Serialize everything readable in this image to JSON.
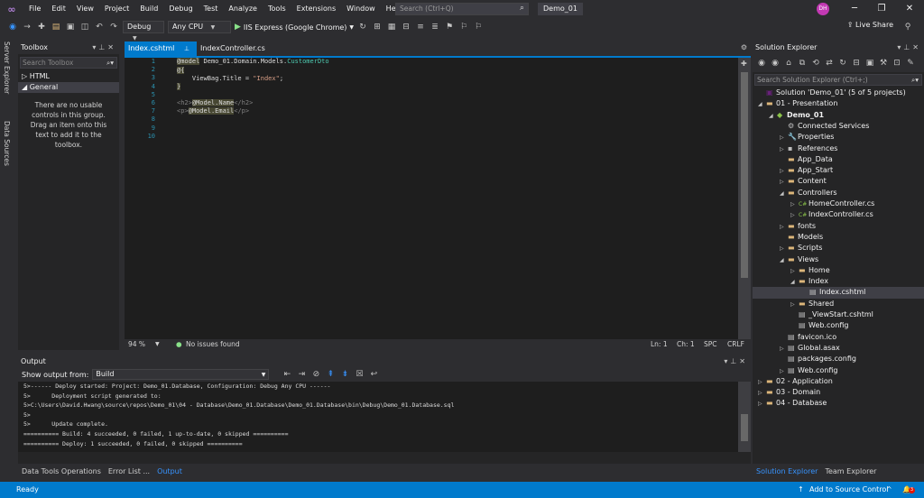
{
  "menu": {
    "items": [
      "File",
      "Edit",
      "View",
      "Project",
      "Build",
      "Debug",
      "Test",
      "Analyze",
      "Tools",
      "Extensions",
      "Window",
      "Help"
    ],
    "search_placeholder": "Search (Ctrl+Q)",
    "solution_name": "Demo_01",
    "avatar_initials": "DH"
  },
  "toolbar": {
    "configuration": "Debug",
    "platform": "Any CPU",
    "run_target": "IIS Express (Google Chrome)",
    "live_share": "Live Share"
  },
  "left_strip": {
    "tab1": "Server Explorer",
    "tab2": "Data Sources"
  },
  "toolbox": {
    "title": "Toolbox",
    "search_placeholder": "Search Toolbox",
    "groups": [
      {
        "label": "HTML",
        "expanded": false
      },
      {
        "label": "General",
        "expanded": true
      }
    ],
    "empty_message": "There are no usable controls in this group. Drag an item onto this text to add it to the toolbox."
  },
  "editor": {
    "tabs": [
      "Index.cshtml",
      "IndexController.cs"
    ],
    "line_numbers": [
      "1",
      "2",
      "3",
      "4",
      "5",
      "6",
      "7",
      "8",
      "9",
      "10"
    ],
    "lines": {
      "l1_directive": "@model",
      "l1_ns": " Demo_01.Domain.Models.",
      "l1_type": "CustomerDto",
      "l2": "@{",
      "l3_prop": "ViewBag.Title = ",
      "l3_str": "\"Index\"",
      "l3_end": ";",
      "l4": "}",
      "l6_open": "<h2>",
      "l6_expr": "@Model.Name",
      "l6_close": "</h2>",
      "l7_open": "<p>",
      "l7_expr": "@Model.Email",
      "l7_close": "</p>"
    },
    "status": {
      "zoom": "94 %",
      "issues": "No issues found",
      "line": "Ln: 1",
      "char": "Ch: 1",
      "spc": "SPC",
      "eol": "CRLF"
    }
  },
  "output": {
    "title": "Output",
    "show_from_label": "Show output from:",
    "source": "Build",
    "lines": [
      "5>------ Deploy started: Project: Demo_01.Database, Configuration: Debug Any CPU ------",
      "5>      Deployment script generated to:",
      "5>C:\\Users\\David.Hwang\\source\\repos\\Demo_01\\04 - Database\\Demo_01.Database\\Demo_01.Database\\bin\\Debug\\Demo_01.Database.sql",
      "5>",
      "5>      Update complete.",
      "========== Build: 4 succeeded, 0 failed, 1 up-to-date, 0 skipped ==========",
      "========== Deploy: 1 succeeded, 0 failed, 0 skipped =========="
    ]
  },
  "bottom_tabs": [
    "Data Tools Operations",
    "Error List ...",
    "Output"
  ],
  "solution_explorer": {
    "title": "Solution Explorer",
    "search_placeholder": "Search Solution Explorer (Ctrl+;)",
    "tree": [
      {
        "label": "Solution 'Demo_01' (5 of 5 projects)",
        "depth": 0,
        "exp": "",
        "icon": "solution"
      },
      {
        "label": "01 - Presentation",
        "depth": 0,
        "exp": "open",
        "icon": "folder"
      },
      {
        "label": "Demo_01",
        "depth": 1,
        "exp": "open",
        "icon": "project",
        "bold": true
      },
      {
        "label": "Connected Services",
        "depth": 2,
        "exp": "",
        "icon": "services"
      },
      {
        "label": "Properties",
        "depth": 2,
        "exp": "closed",
        "icon": "wrench"
      },
      {
        "label": "References",
        "depth": 2,
        "exp": "closed",
        "icon": "refs"
      },
      {
        "label": "App_Data",
        "depth": 2,
        "exp": "",
        "icon": "folder"
      },
      {
        "label": "App_Start",
        "depth": 2,
        "exp": "closed",
        "icon": "folder"
      },
      {
        "label": "Content",
        "depth": 2,
        "exp": "closed",
        "icon": "folder"
      },
      {
        "label": "Controllers",
        "depth": 2,
        "exp": "open",
        "icon": "folder"
      },
      {
        "label": "HomeController.cs",
        "depth": 3,
        "exp": "closed",
        "icon": "cs"
      },
      {
        "label": "IndexController.cs",
        "depth": 3,
        "exp": "closed",
        "icon": "cs"
      },
      {
        "label": "fonts",
        "depth": 2,
        "exp": "closed",
        "icon": "folder"
      },
      {
        "label": "Models",
        "depth": 2,
        "exp": "",
        "icon": "folder"
      },
      {
        "label": "Scripts",
        "depth": 2,
        "exp": "closed",
        "icon": "folder"
      },
      {
        "label": "Views",
        "depth": 2,
        "exp": "open",
        "icon": "folder"
      },
      {
        "label": "Home",
        "depth": 3,
        "exp": "closed",
        "icon": "folder"
      },
      {
        "label": "Index",
        "depth": 3,
        "exp": "open",
        "icon": "folder"
      },
      {
        "label": "Index.cshtml",
        "depth": 4,
        "exp": "",
        "icon": "cshtml",
        "selected": true
      },
      {
        "label": "Shared",
        "depth": 3,
        "exp": "closed",
        "icon": "folder"
      },
      {
        "label": "_ViewStart.cshtml",
        "depth": 3,
        "exp": "",
        "icon": "cshtml"
      },
      {
        "label": "Web.config",
        "depth": 3,
        "exp": "",
        "icon": "config"
      },
      {
        "label": "favicon.ico",
        "depth": 2,
        "exp": "",
        "icon": "file"
      },
      {
        "label": "Global.asax",
        "depth": 2,
        "exp": "closed",
        "icon": "file"
      },
      {
        "label": "packages.config",
        "depth": 2,
        "exp": "",
        "icon": "config"
      },
      {
        "label": "Web.config",
        "depth": 2,
        "exp": "closed",
        "icon": "config"
      },
      {
        "label": "02 - Application",
        "depth": 0,
        "exp": "closed",
        "icon": "folder"
      },
      {
        "label": "03 - Domain",
        "depth": 0,
        "exp": "closed",
        "icon": "folder"
      },
      {
        "label": "04 - Database",
        "depth": 0,
        "exp": "closed",
        "icon": "folder"
      }
    ],
    "tabs": [
      "Solution Explorer",
      "Team Explorer"
    ]
  },
  "statusbar": {
    "ready": "Ready",
    "source_control": "Add to Source Control",
    "notif_count": "3"
  },
  "colors": {
    "accent": "#007acc",
    "background": "#2d2d30",
    "editor_bg": "#1e1e1e"
  }
}
